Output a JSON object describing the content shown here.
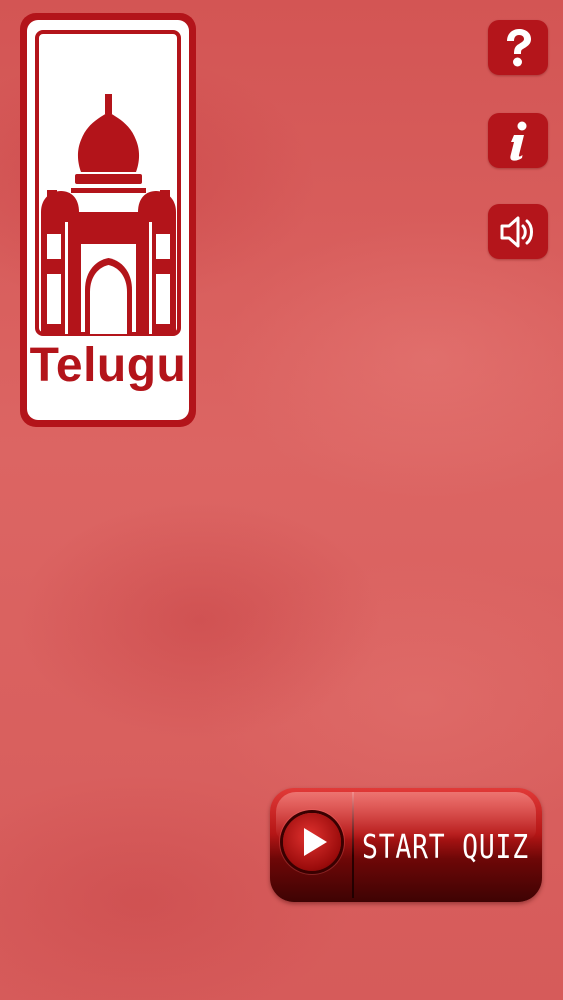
{
  "logo": {
    "text": "Telugu",
    "icon": "temple-monument-icon"
  },
  "side_buttons": {
    "help": {
      "icon": "question-mark-icon",
      "glyph": "?"
    },
    "info": {
      "icon": "info-icon",
      "glyph": "i"
    },
    "sound": {
      "icon": "speaker-icon"
    }
  },
  "start_button": {
    "label": "START QUIZ",
    "icon": "play-icon"
  },
  "colors": {
    "brand_red": "#b3141a",
    "background": "#d9605e",
    "white": "#ffffff"
  }
}
